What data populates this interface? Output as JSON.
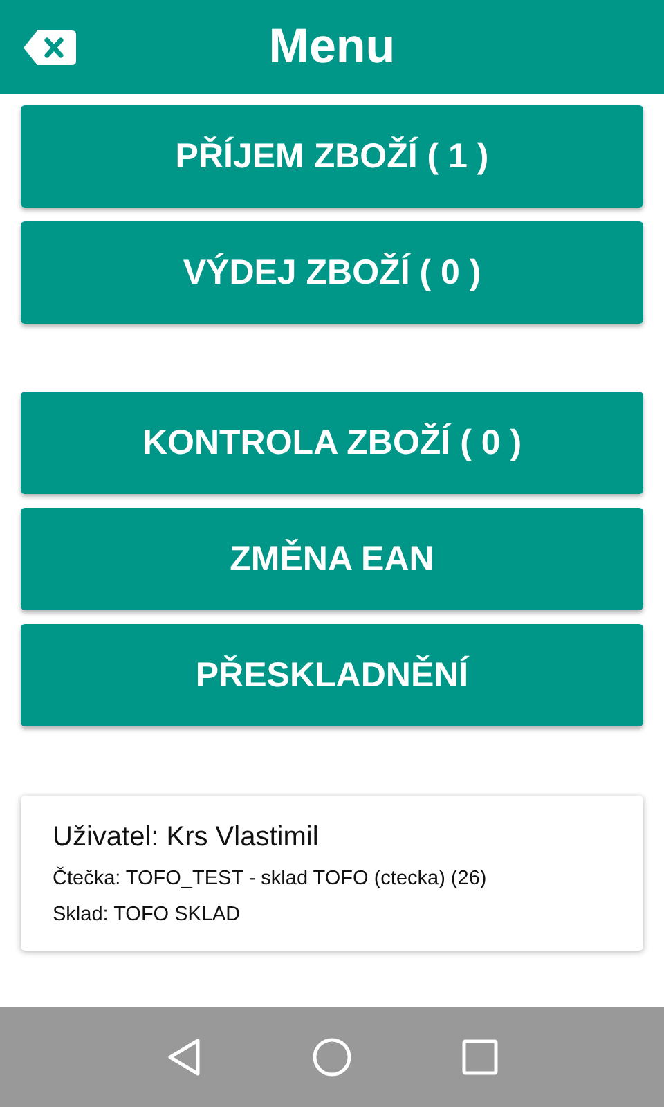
{
  "header": {
    "title": "Menu"
  },
  "button_groups": [
    [
      "PŘÍJEM ZBOŽÍ ( 1 )",
      "VÝDEJ ZBOŽÍ ( 0 )"
    ],
    [
      "KONTROLA ZBOŽÍ ( 0 )",
      "ZMĚNA EAN",
      "PŘESKLADNĚNÍ"
    ]
  ],
  "info_card": {
    "user": "Uživatel: Krs Vlastimil",
    "reader": "Čtečka: TOFO_TEST - sklad TOFO (ctecka) (26)",
    "warehouse": "Sklad: TOFO SKLAD"
  }
}
